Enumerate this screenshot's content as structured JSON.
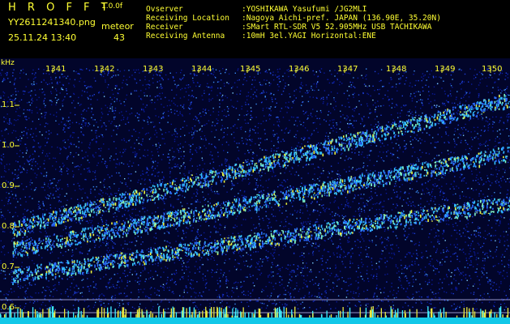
{
  "header": {
    "brand": "H R O F F T",
    "version": "1.0.0f",
    "filename": "YY2611241340.png",
    "meteor_label": "meteor",
    "datetime": "25.11.24 13:40",
    "meteor_count": "43"
  },
  "station": [
    {
      "label": "Ovserver",
      "value": ":YOSHIKAWA Yasufumi /JG2MLI"
    },
    {
      "label": "Receiving Location",
      "value": ":Nagoya Aichi-pref. JAPAN (136.90E, 35.20N)"
    },
    {
      "label": "Receiver",
      "value": ":SMart RTL-SDR V5 52.905MHz USB TACHIKAWA"
    },
    {
      "label": "Receiving Antenna",
      "value": ":10mH 3el.YAGI Horizontal:ENE"
    }
  ],
  "axis": {
    "unit": "kHz",
    "time_labels": [
      "1341",
      "1342",
      "1343",
      "1344",
      "1345",
      "1346",
      "1347",
      "1348",
      "1349",
      "1350"
    ],
    "freq_labels": [
      "1.1",
      "1.0",
      "0.9",
      "0.8",
      "0.7",
      "0.6"
    ]
  },
  "colors": {
    "text": "#ffff33",
    "background": "#000000",
    "spectrogram_base": "#02052a"
  }
}
